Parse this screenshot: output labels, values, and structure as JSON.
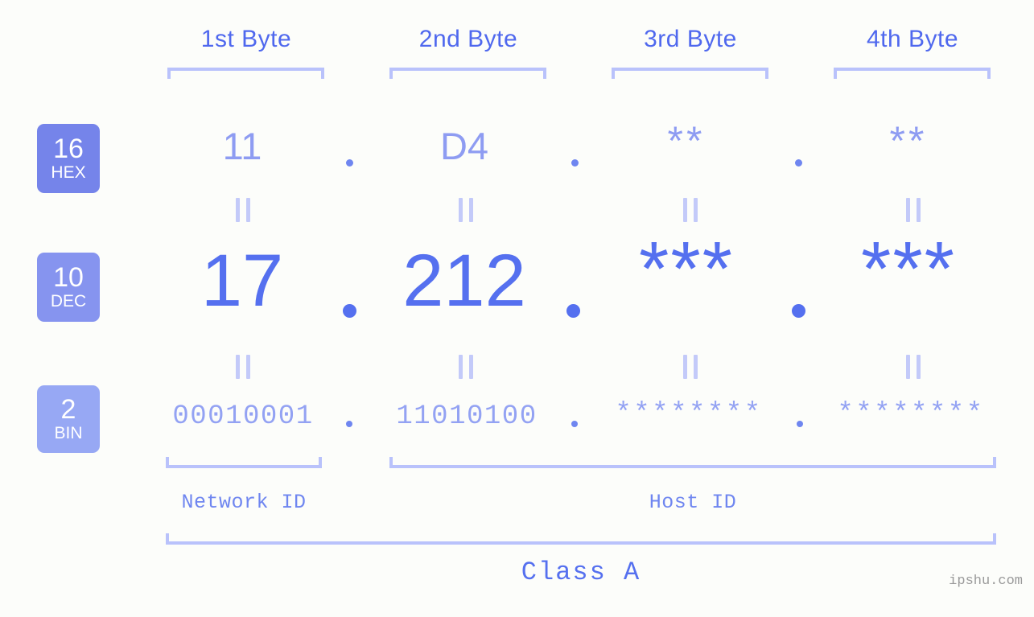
{
  "background_color": "#fcfdfa",
  "accent_colors": {
    "header_blue": "#4f68ee",
    "bracket_light": "#b9c2fb",
    "hex_value": "#8e9cf2",
    "dec_value": "#5570ef",
    "bin_value": "#93a2f3",
    "badge_hex": "#7584ea",
    "badge_dec": "#8694ef",
    "badge_bin": "#97a8f4",
    "watermark": "#9a9a9a"
  },
  "byte_headers": [
    {
      "label": "1st Byte"
    },
    {
      "label": "2nd Byte"
    },
    {
      "label": "3rd Byte"
    },
    {
      "label": "4th Byte"
    }
  ],
  "bases": [
    {
      "number": "16",
      "name": "HEX"
    },
    {
      "number": "10",
      "name": "DEC"
    },
    {
      "number": "2",
      "name": "BIN"
    }
  ],
  "rows": {
    "hex": {
      "base_number": "16",
      "base_name": "HEX",
      "values": [
        "11",
        "D4",
        "**",
        "**"
      ]
    },
    "dec": {
      "base_number": "10",
      "base_name": "DEC",
      "values": [
        "17",
        "212",
        "***",
        "***"
      ]
    },
    "bin": {
      "base_number": "2",
      "base_name": "BIN",
      "values": [
        "00010001",
        "11010100",
        "********",
        "********"
      ]
    }
  },
  "separators": {
    "dot": ".",
    "equivalence": "="
  },
  "segments": {
    "network_id": "Network ID",
    "host_id": "Host ID"
  },
  "class_label": "Class A",
  "watermark": "ipshu.com"
}
